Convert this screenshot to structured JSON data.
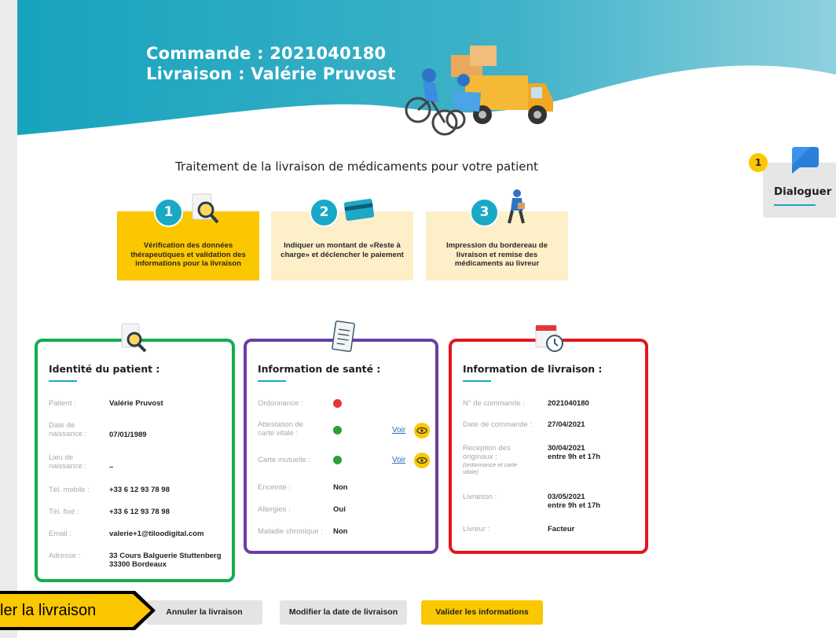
{
  "header": {
    "order_line": "Commande : 2021040180",
    "delivery_line": "Livraison : Valérie Pruvost"
  },
  "subtitle": "Traitement de la livraison de médicaments pour votre patient",
  "steps": [
    {
      "number": "1",
      "text": "Vérification des données thérapeutiques et validation des informations pour la livraison",
      "active": true,
      "icon": "magnifier-document-icon"
    },
    {
      "number": "2",
      "text": "Indiquer un montant de «Reste à charge» et déclencher le paiement",
      "active": false,
      "icon": "credit-card-icon"
    },
    {
      "number": "3",
      "text": "Impression du bordereau de livraison et remise des médicaments au livreur",
      "active": false,
      "icon": "courier-icon"
    }
  ],
  "patient_card": {
    "title": "Identité du patient :",
    "border_color": "#13ad4f",
    "rows": [
      {
        "label": "Patient :",
        "value": "Valérie Pruvost"
      },
      {
        "label": "Date de naissance :",
        "value": "07/01/1989"
      },
      {
        "label": "Lieu de naissance :",
        "value": "–"
      },
      {
        "label": "Tél. mobile :",
        "value": "+33 6 12 93 78 98"
      },
      {
        "label": "Tél. fixé :",
        "value": "+33 6 12 93 78 98"
      },
      {
        "label": "Email :",
        "value": "valerie+1@tiloodigital.com"
      },
      {
        "label": "Adresse :",
        "value": "33 Cours Balguerie Stuttenberg\n33300 Bordeaux"
      }
    ]
  },
  "health_card": {
    "title": "Information de santé :",
    "border_color": "#6b3fa0",
    "rows": [
      {
        "label": "Ordonnance :",
        "status": "error"
      },
      {
        "label": "Attestation de carte vitale :",
        "status": "ok",
        "link": "Voir"
      },
      {
        "label": "Carte mutuelle :",
        "status": "ok",
        "link": "Voir"
      },
      {
        "label": "Enceinte :",
        "value": "Non"
      },
      {
        "label": "Allergies :",
        "value": "Oui"
      },
      {
        "label": "Maladie chronique :",
        "value": "Non"
      }
    ]
  },
  "delivery_card": {
    "title": "Information de livraison :",
    "border_color": "#e3161b",
    "rows": [
      {
        "label": "N° de commande :",
        "value": "2021040180"
      },
      {
        "label": "Date de commande :",
        "value": "27/04/2021"
      },
      {
        "label": "Reception des originaux :",
        "note": "(ordonnance et carte vitale)",
        "value": "30/04/2021\nentre 9h et 17h"
      },
      {
        "label": "Livraison :",
        "value": "03/05/2021\nentre 9h et 17h"
      },
      {
        "label": "Livreur :",
        "value": "Facteur"
      }
    ]
  },
  "dialoguer": {
    "label": "Dialoguer",
    "badge": "1"
  },
  "buttons": {
    "cancel": "Annuler la livraison",
    "change_date": "Modifier la date de livraison",
    "validate": "Valider les informations"
  },
  "callout": {
    "text": "ler la livraison"
  },
  "colors": {
    "accent_teal": "#19a9c6",
    "accent_yellow": "#fbc700",
    "status_ok": "#2e9e3a",
    "status_error": "#e23838"
  }
}
